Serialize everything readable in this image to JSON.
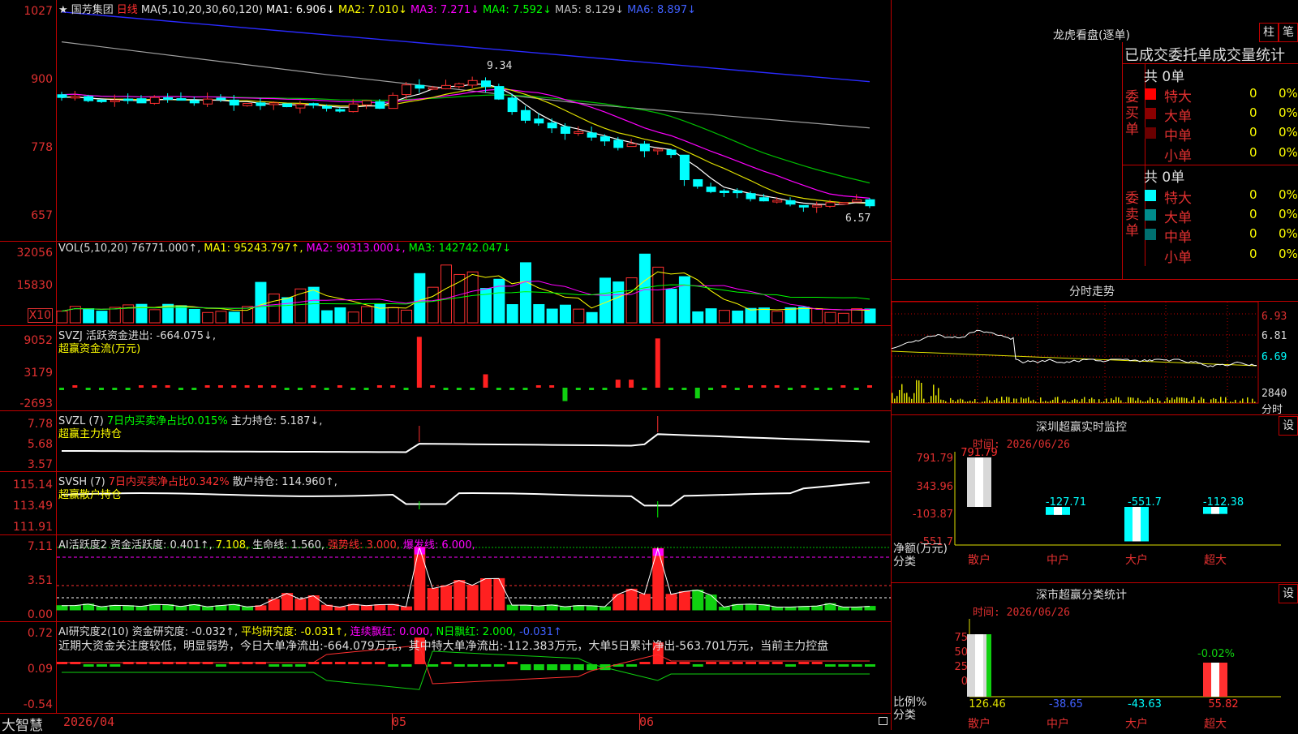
{
  "main": {
    "stock_label": "★ 国芳集团",
    "period_label": "日线",
    "ma_header": "MA(5,10,20,30,60,120)",
    "ma_values": [
      "MA1: 6.906↓",
      "MA2: 7.010↓",
      "MA3: 7.271↓",
      "MA4: 7.592↓",
      "MA5: 8.129↓",
      "MA6: 8.897↓"
    ],
    "ma_colors": [
      "#ffffff",
      "#ffff00",
      "#ff00ff",
      "#00ff00",
      "#c0c0c0",
      "#3030ff"
    ],
    "yticks": [
      "1027",
      "900",
      "778",
      "657"
    ],
    "high_label": "9.34",
    "low_label": "6.57"
  },
  "vol": {
    "header": "VOL(5,10,20)",
    "value": "76771.000↑,",
    "ma1": "MA1: 95243.797↑,",
    "ma2": "MA2: 90313.000↓,",
    "ma3": "MA3: 142742.047↓",
    "yticks": [
      "32056",
      "15830"
    ],
    "unit": "X10"
  },
  "svzj": {
    "header": "SVZJ  活跃资金进出: -664.075↓,",
    "sub": "超赢资金流(万元)",
    "yticks": [
      "9052",
      "3179",
      "-2693"
    ]
  },
  "svzl": {
    "header1": "SVZL (7)",
    "header2": "7日内买卖净占比0.015%",
    "header3": "主力持仓: 5.187↓,",
    "sub": "超赢主力持仓",
    "yticks": [
      "7.78",
      "5.68",
      "3.57"
    ]
  },
  "svsh": {
    "header1": "SVSH (7)",
    "header2": "7日内买卖净占比0.342%",
    "header3": "散户持仓: 114.960↑,",
    "sub": "超赢散户持仓",
    "yticks": [
      "115.14",
      "113.49",
      "111.91"
    ]
  },
  "ai1": {
    "h1": "AI活跃度2",
    "h2": "资金活跃度: 0.401↑,",
    "h3": "7.108,",
    "h4": "生命线: 1.560,",
    "h5": "强势线: 3.000,",
    "h6": "爆发线: 6.000,",
    "yticks": [
      "7.11",
      "3.51",
      "0.00"
    ]
  },
  "ai2": {
    "h1": "AI研究度2(10)",
    "h2": "资金研究度: -0.032↑,",
    "h3": "平均研究度: -0.031↑,",
    "h4": "连续飘红: 0.000,",
    "h5": "N日飘红: 2.000,",
    "h6": "-0.031↑",
    "comment": "近期大资金关注度较低，明显弱势，今日大单净流出:-664.079万元，其中特大单净流出:-112.383万元，大单5日累计净出-563.701万元，当前主力控盘",
    "yticks": [
      "0.72",
      "0.09",
      "-0.54"
    ]
  },
  "bottom": {
    "brand": "大智慧",
    "dates": [
      "2026/04",
      "05",
      "06"
    ]
  },
  "dragon": {
    "title": "龙虎看盘(逐单)",
    "btn1": "柱",
    "btn2": "笔",
    "subtitle": "已成交委托单成交量统计",
    "buy": {
      "side_label": "委买单",
      "total": "共 0单",
      "rows": [
        {
          "label": "特大",
          "count": "0",
          "pct": "0%",
          "color": "#ff0000"
        },
        {
          "label": "大单",
          "count": "0",
          "pct": "0%",
          "color": "#8b0000"
        },
        {
          "label": "中单",
          "count": "0",
          "pct": "0%",
          "color": "#6b0000"
        },
        {
          "label": "小单",
          "count": "0",
          "pct": "0%",
          "color": "#000000"
        }
      ]
    },
    "sell": {
      "side_label": "委卖单",
      "total": "共 0单",
      "rows": [
        {
          "label": "特大",
          "count": "0",
          "pct": "0%",
          "color": "#00ffff"
        },
        {
          "label": "大单",
          "count": "0",
          "pct": "0%",
          "color": "#008b8b"
        },
        {
          "label": "中单",
          "count": "0",
          "pct": "0%",
          "color": "#007070"
        },
        {
          "label": "小单",
          "count": "0",
          "pct": "0%",
          "color": "#000000"
        }
      ]
    }
  },
  "intraday": {
    "title": "分时走势",
    "yticks": [
      "6.93",
      "6.81",
      "6.69"
    ],
    "vol_label": "2840",
    "unit": "分时"
  },
  "monitor": {
    "title": "深圳超赢实时监控",
    "setting": "设",
    "time": "时间: 2026/06/26",
    "yticks": [
      "791.79",
      "343.96",
      "-103.87",
      "-551.7"
    ],
    "axis_label1": "净额(万元)",
    "axis_label2": "分类",
    "categories": [
      "散户",
      "中户",
      "大户",
      "超大"
    ],
    "values": [
      791.79,
      -127.71,
      -551.7,
      -112.38
    ],
    "value_labels": [
      "791.79",
      "-127.71",
      "-551.7",
      "-112.38"
    ]
  },
  "classify": {
    "title": "深市超赢分类统计",
    "setting": "设",
    "time": "时间: 2026/06/26",
    "yticks": [
      "75",
      "50",
      "25",
      "0"
    ],
    "axis_label1": "比例%",
    "axis_label2": "分类",
    "categories": [
      "散户",
      "中户",
      "大户",
      "超大"
    ],
    "values": [
      126.46,
      -38.65,
      -43.63,
      55.82
    ],
    "value_labels": [
      "126.46",
      "-38.65",
      "-43.63",
      "55.82"
    ],
    "top_label": "-0.02%"
  }
}
